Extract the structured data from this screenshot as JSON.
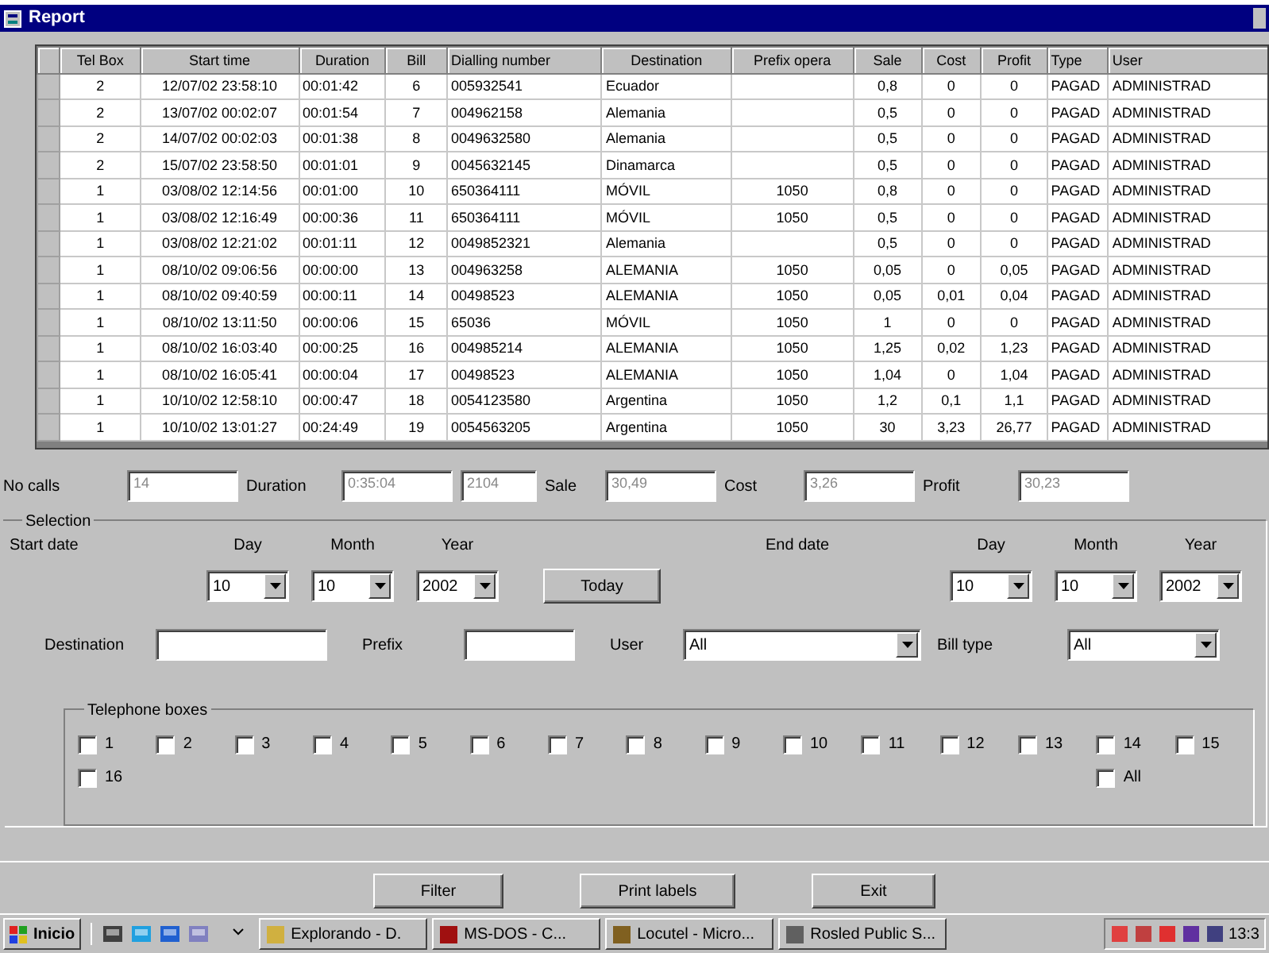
{
  "window": {
    "title": "Report"
  },
  "table": {
    "columns": [
      "Tel Box",
      "Start time",
      "Duration",
      "Bill",
      "Dialling number",
      "Destination",
      "Prefix opera",
      "Sale",
      "Cost",
      "Profit",
      "Type",
      "User"
    ],
    "rows": [
      [
        "2",
        "12/07/02 23:58:10",
        "00:01:42",
        "6",
        "005932541",
        "Ecuador",
        "",
        "0,8",
        "0",
        "0",
        "PAGAD",
        "ADMINISTRAD"
      ],
      [
        "2",
        "13/07/02 00:02:07",
        "00:01:54",
        "7",
        "004962158",
        "Alemania",
        "",
        "0,5",
        "0",
        "0",
        "PAGAD",
        "ADMINISTRAD"
      ],
      [
        "2",
        "14/07/02 00:02:03",
        "00:01:38",
        "8",
        "0049632580",
        "Alemania",
        "",
        "0,5",
        "0",
        "0",
        "PAGAD",
        "ADMINISTRAD"
      ],
      [
        "2",
        "15/07/02 23:58:50",
        "00:01:01",
        "9",
        "0045632145",
        "Dinamarca",
        "",
        "0,5",
        "0",
        "0",
        "PAGAD",
        "ADMINISTRAD"
      ],
      [
        "1",
        "03/08/02 12:14:56",
        "00:01:00",
        "10",
        "650364111",
        "MÓVIL",
        "1050",
        "0,8",
        "0",
        "0",
        "PAGAD",
        "ADMINISTRAD"
      ],
      [
        "1",
        "03/08/02 12:16:49",
        "00:00:36",
        "11",
        "650364111",
        "MÓVIL",
        "1050",
        "0,5",
        "0",
        "0",
        "PAGAD",
        "ADMINISTRAD"
      ],
      [
        "1",
        "03/08/02 12:21:02",
        "00:01:11",
        "12",
        "0049852321",
        "Alemania",
        "",
        "0,5",
        "0",
        "0",
        "PAGAD",
        "ADMINISTRAD"
      ],
      [
        "1",
        "08/10/02 09:06:56",
        "00:00:00",
        "13",
        "004963258",
        "ALEMANIA",
        "1050",
        "0,05",
        "0",
        "0,05",
        "PAGAD",
        "ADMINISTRAD"
      ],
      [
        "1",
        "08/10/02 09:40:59",
        "00:00:11",
        "14",
        "00498523",
        "ALEMANIA",
        "1050",
        "0,05",
        "0,01",
        "0,04",
        "PAGAD",
        "ADMINISTRAD"
      ],
      [
        "1",
        "08/10/02 13:11:50",
        "00:00:06",
        "15",
        "65036",
        "MÓVIL",
        "1050",
        "1",
        "0",
        "0",
        "PAGAD",
        "ADMINISTRAD"
      ],
      [
        "1",
        "08/10/02 16:03:40",
        "00:00:25",
        "16",
        "004985214",
        "ALEMANIA",
        "1050",
        "1,25",
        "0,02",
        "1,23",
        "PAGAD",
        "ADMINISTRAD"
      ],
      [
        "1",
        "08/10/02 16:05:41",
        "00:00:04",
        "17",
        "00498523",
        "ALEMANIA",
        "1050",
        "1,04",
        "0",
        "1,04",
        "PAGAD",
        "ADMINISTRAD"
      ],
      [
        "1",
        "10/10/02 12:58:10",
        "00:00:47",
        "18",
        "0054123580",
        "Argentina",
        "1050",
        "1,2",
        "0,1",
        "1,1",
        "PAGAD",
        "ADMINISTRAD"
      ],
      [
        "1",
        "10/10/02 13:01:27",
        "00:24:49",
        "19",
        "0054563205",
        "Argentina",
        "1050",
        "30",
        "3,23",
        "26,77",
        "PAGAD",
        "ADMINISTRAD"
      ]
    ]
  },
  "summary": [
    {
      "label": "No calls",
      "values": [
        "14"
      ]
    },
    {
      "label": "Duration",
      "values": [
        "0:35:04",
        "2104"
      ]
    },
    {
      "label": "Sale",
      "values": [
        "30,49"
      ]
    },
    {
      "label": "Cost",
      "values": [
        "3,26"
      ]
    },
    {
      "label": "Profit",
      "values": [
        "30,23"
      ]
    }
  ],
  "selection": {
    "title": "Selection",
    "start_date": {
      "label": "Start date",
      "day_label": "Day",
      "day": "10",
      "month_label": "Month",
      "month": "10",
      "year_label": "Year",
      "year": "2002"
    },
    "today_button": "Today",
    "end_date": {
      "label": "End date",
      "day_label": "Day",
      "day": "10",
      "month_label": "Month",
      "month": "10",
      "year_label": "Year",
      "year": "2002"
    },
    "destination_label": "Destination",
    "prefix_label": "Prefix",
    "user_label": "User",
    "user": "All",
    "bill_type_label": "Bill type",
    "bill_type": "All",
    "boxes_title": "Telephone boxes",
    "boxes": [
      {
        "label": "1",
        "checked": false,
        "kind": "box"
      },
      {
        "label": "2",
        "checked": false,
        "kind": "box"
      },
      {
        "label": "3",
        "checked": false,
        "kind": "box"
      },
      {
        "label": "4",
        "checked": false,
        "kind": "box"
      },
      {
        "label": "5",
        "checked": false,
        "kind": "box"
      },
      {
        "label": "6",
        "checked": false,
        "kind": "box"
      },
      {
        "label": "7",
        "checked": false,
        "kind": "box"
      },
      {
        "label": "8",
        "checked": false,
        "kind": "box"
      },
      {
        "label": "9",
        "checked": false,
        "kind": "box"
      },
      {
        "label": "10",
        "checked": false,
        "kind": "box"
      },
      {
        "label": "11",
        "checked": false,
        "kind": "box"
      },
      {
        "label": "12",
        "checked": false,
        "kind": "box"
      },
      {
        "label": "13",
        "checked": false,
        "kind": "box"
      },
      {
        "label": "14",
        "checked": false,
        "kind": "box"
      },
      {
        "label": "15",
        "checked": false,
        "kind": "box"
      },
      {
        "label": "16",
        "checked": false,
        "kind": "box"
      },
      {
        "label": "All",
        "checked": false,
        "kind": "all"
      }
    ]
  },
  "buttons": [
    "Filter",
    "Print labels",
    "Exit"
  ],
  "taskbar": {
    "start": "Inicio",
    "tasks": [
      "Explorando - D.",
      "MS-DOS - C...",
      "Locutel - Micro...",
      "Rosled Public S..."
    ],
    "clock": "13:3"
  }
}
